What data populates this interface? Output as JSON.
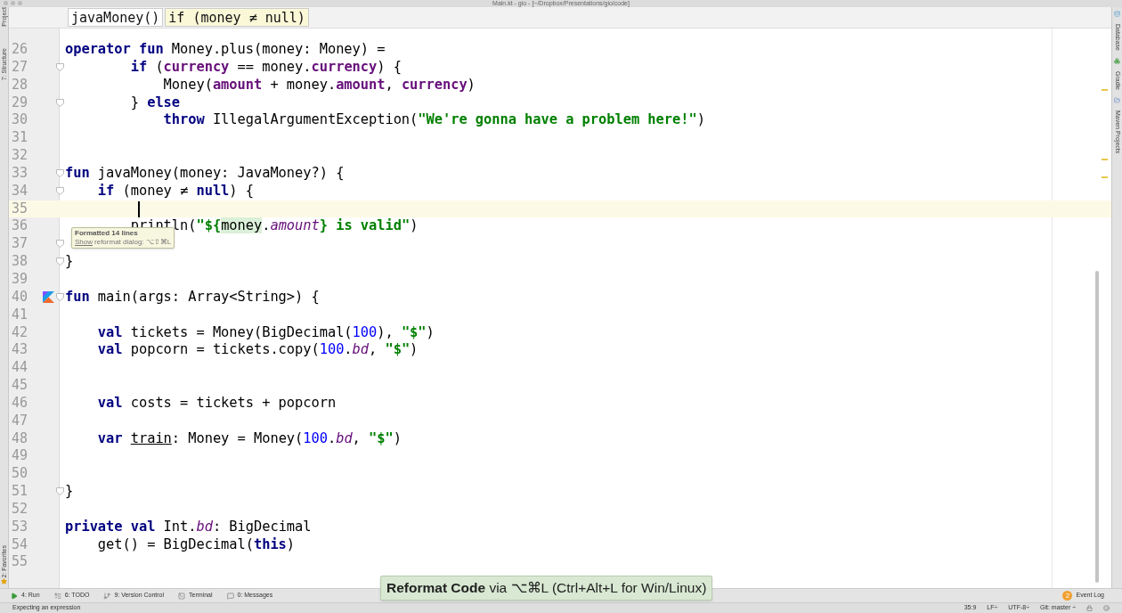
{
  "window": {
    "title": "Main.kt - gio - [~/Dropbox/Presentations/gio/code]"
  },
  "left_tool_strip": [
    "Project",
    "7: Structure",
    "2: Favorites"
  ],
  "right_tool_strip": [
    "Database",
    "Gradle",
    "Maven Projects"
  ],
  "breadcrumbs": [
    {
      "label": "javaMoney()",
      "selected": false
    },
    {
      "label": "if (money ≠ null)",
      "selected": true
    }
  ],
  "editor": {
    "lines": [
      {
        "number": "26",
        "current": false,
        "fold": false,
        "run_marker": false,
        "tokens": [
          {
            "kind": "keyword",
            "text": "operator fun"
          },
          {
            "kind": "plain",
            "text": " Money.plus(money: Money) ="
          }
        ]
      },
      {
        "number": "27",
        "current": false,
        "fold": true,
        "run_marker": false,
        "tokens": [
          {
            "kind": "keyword",
            "text": "        if"
          },
          {
            "kind": "plain",
            "text": " ("
          },
          {
            "kind": "property",
            "text": "currency"
          },
          {
            "kind": "plain",
            "text": " == money."
          },
          {
            "kind": "property",
            "text": "currency"
          },
          {
            "kind": "plain",
            "text": ") {"
          }
        ]
      },
      {
        "number": "28",
        "current": false,
        "fold": false,
        "run_marker": false,
        "tokens": [
          {
            "kind": "plain",
            "text": "            Money("
          },
          {
            "kind": "property",
            "text": "amount"
          },
          {
            "kind": "plain",
            "text": " + money."
          },
          {
            "kind": "property",
            "text": "amount"
          },
          {
            "kind": "plain",
            "text": ", "
          },
          {
            "kind": "property",
            "text": "currency"
          },
          {
            "kind": "plain",
            "text": ")"
          }
        ]
      },
      {
        "number": "29",
        "current": false,
        "fold": true,
        "run_marker": false,
        "tokens": [
          {
            "kind": "plain",
            "text": "        } "
          },
          {
            "kind": "keyword",
            "text": "else"
          }
        ]
      },
      {
        "number": "30",
        "current": false,
        "fold": false,
        "run_marker": false,
        "tokens": [
          {
            "kind": "keyword",
            "text": "            throw"
          },
          {
            "kind": "plain",
            "text": " IllegalArgumentException("
          },
          {
            "kind": "string",
            "text": "\"We're gonna have a problem here!\""
          },
          {
            "kind": "plain",
            "text": ")"
          }
        ]
      },
      {
        "number": "31",
        "current": false,
        "fold": false,
        "run_marker": false
      },
      {
        "number": "32",
        "current": false,
        "fold": false,
        "run_marker": false
      },
      {
        "number": "33",
        "current": false,
        "fold": true,
        "run_marker": false,
        "tokens": [
          {
            "kind": "keyword",
            "text": "fun"
          },
          {
            "kind": "plain",
            "text": " javaMoney(money: JavaMoney?) {"
          }
        ]
      },
      {
        "number": "34",
        "current": false,
        "fold": true,
        "run_marker": false,
        "tokens": [
          {
            "kind": "keyword",
            "text": "    if"
          },
          {
            "kind": "plain",
            "text": " (money ≠ "
          },
          {
            "kind": "keyword",
            "text": "null"
          },
          {
            "kind": "plain",
            "text": ") {"
          }
        ]
      },
      {
        "number": "35",
        "current": true,
        "fold": false,
        "run_marker": false
      },
      {
        "number": "36",
        "current": false,
        "fold": false,
        "run_marker": false,
        "tokens": [
          {
            "kind": "plain",
            "text": "        println("
          },
          {
            "kind": "string",
            "text": "\"${"
          },
          {
            "kind": "highlight",
            "text": "money"
          },
          {
            "kind": "plain",
            "text": "."
          },
          {
            "kind": "italic",
            "text": "amount"
          },
          {
            "kind": "string",
            "text": "} is valid\""
          },
          {
            "kind": "plain",
            "text": ")"
          }
        ]
      },
      {
        "number": "37",
        "current": false,
        "fold": true,
        "run_marker": false
      },
      {
        "number": "38",
        "current": false,
        "fold": true,
        "run_marker": false,
        "tokens": [
          {
            "kind": "plain",
            "text": "}"
          }
        ]
      },
      {
        "number": "39",
        "current": false,
        "fold": false,
        "run_marker": false
      },
      {
        "number": "40",
        "current": false,
        "fold": true,
        "run_marker": true,
        "tokens": [
          {
            "kind": "keyword",
            "text": "fun"
          },
          {
            "kind": "plain",
            "text": " main(args: Array<String>) {"
          }
        ]
      },
      {
        "number": "41",
        "current": false,
        "fold": false,
        "run_marker": false
      },
      {
        "number": "42",
        "current": false,
        "fold": false,
        "run_marker": false,
        "tokens": [
          {
            "kind": "keyword",
            "text": "    val"
          },
          {
            "kind": "plain",
            "text": " tickets = Money(BigDecimal("
          },
          {
            "kind": "number",
            "text": "100"
          },
          {
            "kind": "plain",
            "text": "), "
          },
          {
            "kind": "string",
            "text": "\"$\""
          },
          {
            "kind": "plain",
            "text": ")"
          }
        ]
      },
      {
        "number": "43",
        "current": false,
        "fold": false,
        "run_marker": false,
        "tokens": [
          {
            "kind": "keyword",
            "text": "    val"
          },
          {
            "kind": "plain",
            "text": " popcorn = tickets.copy("
          },
          {
            "kind": "number",
            "text": "100"
          },
          {
            "kind": "plain",
            "text": "."
          },
          {
            "kind": "italic",
            "text": "bd"
          },
          {
            "kind": "plain",
            "text": ", "
          },
          {
            "kind": "string",
            "text": "\"$\""
          },
          {
            "kind": "plain",
            "text": ")"
          }
        ]
      },
      {
        "number": "44",
        "current": false,
        "fold": false,
        "run_marker": false
      },
      {
        "number": "45",
        "current": false,
        "fold": false,
        "run_marker": false
      },
      {
        "number": "46",
        "current": false,
        "fold": false,
        "run_marker": false,
        "tokens": [
          {
            "kind": "keyword",
            "text": "    val"
          },
          {
            "kind": "plain",
            "text": " costs = tickets + popcorn"
          }
        ]
      },
      {
        "number": "47",
        "current": false,
        "fold": false,
        "run_marker": false
      },
      {
        "number": "48",
        "current": false,
        "fold": false,
        "run_marker": false,
        "tokens": [
          {
            "kind": "keyword",
            "text": "    var "
          },
          {
            "kind": "underlined",
            "text": "train"
          },
          {
            "kind": "plain",
            "text": ": Money = Money("
          },
          {
            "kind": "number",
            "text": "100"
          },
          {
            "kind": "plain",
            "text": "."
          },
          {
            "kind": "italic",
            "text": "bd"
          },
          {
            "kind": "plain",
            "text": ", "
          },
          {
            "kind": "string",
            "text": "\"$\""
          },
          {
            "kind": "plain",
            "text": ")"
          }
        ]
      },
      {
        "number": "49",
        "current": false,
        "fold": false,
        "run_marker": false
      },
      {
        "number": "50",
        "current": false,
        "fold": false,
        "run_marker": false
      },
      {
        "number": "51",
        "current": false,
        "fold": true,
        "run_marker": false,
        "tokens": [
          {
            "kind": "plain",
            "text": "}"
          }
        ]
      },
      {
        "number": "52",
        "current": false,
        "fold": false,
        "run_marker": false
      },
      {
        "number": "53",
        "current": false,
        "fold": false,
        "run_marker": false,
        "tokens": [
          {
            "kind": "keyword",
            "text": "private val"
          },
          {
            "kind": "plain",
            "text": " Int."
          },
          {
            "kind": "italic",
            "text": "bd"
          },
          {
            "kind": "plain",
            "text": ": BigDecimal"
          }
        ]
      },
      {
        "number": "54",
        "current": false,
        "fold": false,
        "run_marker": false,
        "tokens": [
          {
            "kind": "plain",
            "text": "    get() = BigDecimal("
          },
          {
            "kind": "keyword",
            "text": "this"
          },
          {
            "kind": "plain",
            "text": ")"
          }
        ]
      },
      {
        "number": "55",
        "current": false,
        "fold": false,
        "run_marker": false
      }
    ]
  },
  "tooltip": {
    "title": "Formatted 14 lines",
    "link": "Show",
    "text": "reformat dialog: ⌥⇧⌘L"
  },
  "banner": "**Reformat Code** via ⌥⌘L (Ctrl+Alt+L for Win/Linux)",
  "bottom_tools": [
    {
      "label": "4: Run"
    },
    {
      "label": "6: TODO"
    },
    {
      "label": "9: Version Control"
    },
    {
      "label": "Terminal"
    },
    {
      "label": "0: Messages"
    }
  ],
  "event_log": {
    "count": "2",
    "label": "Event Log"
  },
  "status_bar": {
    "message": "Expecting an expression",
    "items": [
      "35:9",
      "LF÷",
      "UTF-8÷",
      "Git: master ÷"
    ]
  }
}
